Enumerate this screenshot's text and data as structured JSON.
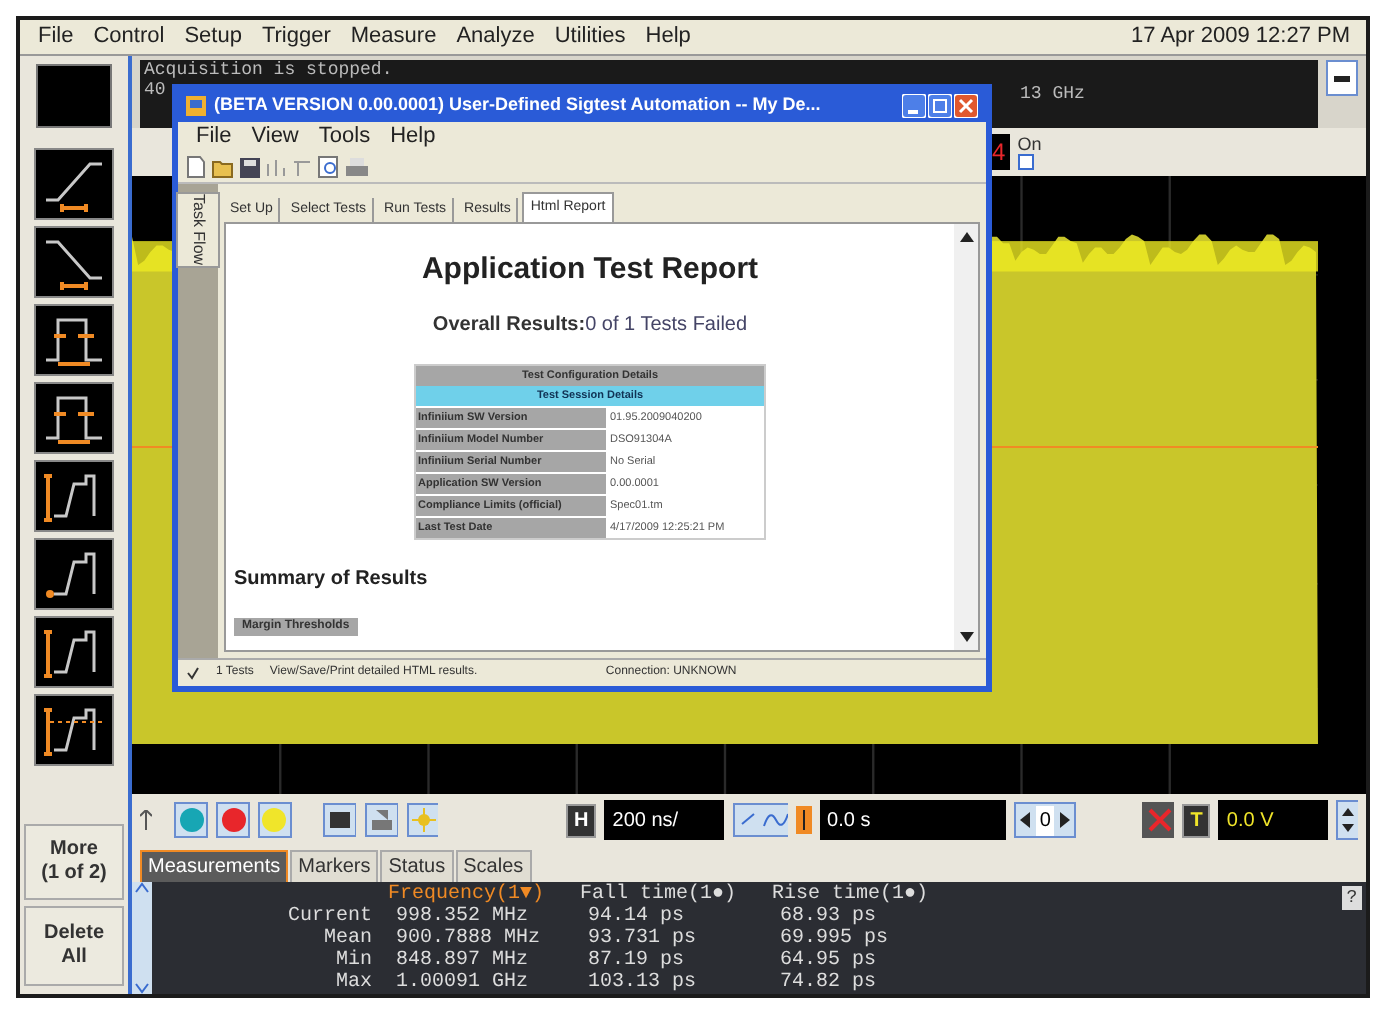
{
  "menu": [
    "File",
    "Control",
    "Setup",
    "Trigger",
    "Measure",
    "Analyze",
    "Utilities",
    "Help"
  ],
  "datetime": "17 Apr 2009 12:27 PM",
  "acquisition": {
    "status": "Acquisition is stopped.",
    "line_2": "40",
    "bandwidth": "13 GHz"
  },
  "channel": {
    "number": "4",
    "on_label": "On",
    "on": false
  },
  "sidebar": {
    "more": [
      "More",
      "(1 of 2)"
    ],
    "delete": [
      "Delete",
      "All"
    ]
  },
  "dialog": {
    "title": "(BETA VERSION 0.00.0001) User-Defined Sigtest Automation -- My De...",
    "menu": [
      "File",
      "View",
      "Tools",
      "Help"
    ],
    "side_tab": "Task Flow",
    "tabs": [
      {
        "label": "Set Up",
        "selected": false
      },
      {
        "label": "Select Tests",
        "selected": false
      },
      {
        "label": "Run Tests",
        "selected": false
      },
      {
        "label": "Results",
        "selected": false
      },
      {
        "label": "Html Report",
        "selected": true
      }
    ],
    "report": {
      "title": "Application Test Report",
      "overall_label": "Overall Results:",
      "overall_value": "0 of 1 Tests Failed",
      "table_title": "Test Configuration Details",
      "table_subtitle": "Test Session Details",
      "rows": [
        {
          "label": "Infiniium SW Version",
          "value": "01.95.2009040200"
        },
        {
          "label": "Infiniium Model Number",
          "value": "DSO91304A"
        },
        {
          "label": "Infiniium Serial Number",
          "value": "No Serial"
        },
        {
          "label": "Application SW Version",
          "value": "0.00.0001"
        },
        {
          "label": "Compliance Limits (official)",
          "value": "Spec01.tm"
        },
        {
          "label": "Last Test Date",
          "value": "4/17/2009 12:25:21 PM"
        }
      ],
      "summary": "Summary of Results",
      "section": "Margin Thresholds"
    },
    "status": {
      "tests_checked": true,
      "tests": "1 Tests",
      "hint": "View/Save/Print detailed HTML results.",
      "connection": "Connection: UNKNOWN"
    }
  },
  "toolbar": {
    "channels": [
      {
        "color": "#17a6b4"
      },
      {
        "color": "#e8262b"
      },
      {
        "color": "#f0e52a"
      }
    ],
    "horizontal_letter": "H",
    "timebase": "200 ns/",
    "delay": "0.0 s",
    "zoom": "0",
    "trigger_letter": "T",
    "trigger_level": "0.0 V"
  },
  "measurement_tabs": [
    {
      "label": "Measurements",
      "selected": true
    },
    {
      "label": "Markers",
      "selected": false
    },
    {
      "label": "Status",
      "selected": false
    },
    {
      "label": "Scales",
      "selected": false
    }
  ],
  "measurements": {
    "columns": [
      "Frequency(1▼)",
      "Fall time(1●)",
      "Rise time(1●)"
    ],
    "rows": [
      {
        "label": "Current",
        "values": [
          "998.352 MHz",
          "94.14 ps",
          "68.93 ps"
        ]
      },
      {
        "label": "Mean",
        "values": [
          "900.7888 MHz",
          "93.731 ps",
          "69.995 ps"
        ]
      },
      {
        "label": "Min",
        "values": [
          "848.897 MHz",
          "87.19 ps",
          "64.95 ps"
        ]
      },
      {
        "label": "Max",
        "values": [
          "1.00091 GHz",
          "103.13 ps",
          "74.82 ps"
        ]
      }
    ],
    "help": "?"
  }
}
